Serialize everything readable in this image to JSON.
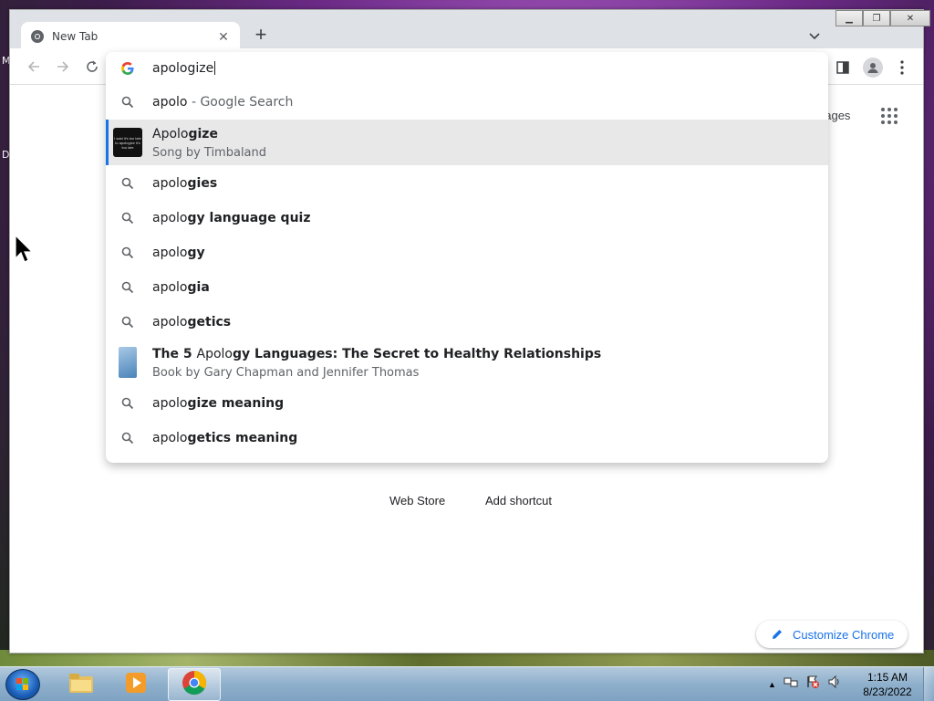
{
  "desktop": {
    "edge_letters": [
      "M",
      "D"
    ]
  },
  "browser": {
    "tab": {
      "title": "New Tab"
    },
    "omnibox": {
      "input_value": "apologize",
      "suggestions": [
        {
          "type": "search",
          "prefix": "apolo",
          "bold": "",
          "suffix": " - Google Search",
          "dim": true
        },
        {
          "type": "entity",
          "title_prefix": "Apolo",
          "title_bold": "gize",
          "subtitle": "Song by Timbaland",
          "thumb_text": "I said it's too late to apologize it's too late"
        },
        {
          "type": "search",
          "prefix": "apolo",
          "bold": "gies"
        },
        {
          "type": "search",
          "prefix": "apolo",
          "bold": "gy language quiz"
        },
        {
          "type": "search",
          "prefix": "apolo",
          "bold": "gy"
        },
        {
          "type": "search",
          "prefix": "apolo",
          "bold": "gia"
        },
        {
          "type": "search",
          "prefix": "apolo",
          "bold": "getics"
        },
        {
          "type": "entity",
          "title_bold_pre": "The 5 ",
          "title_prefix": "Apolo",
          "title_bold": "gy Languages: The Secret to Healthy Relationships",
          "subtitle": "Book by Gary Chapman and Jennifer Thomas"
        },
        {
          "type": "search",
          "prefix": "apolo",
          "bold": "gize meaning"
        },
        {
          "type": "search",
          "prefix": "apolo",
          "bold": "getics meaning"
        }
      ]
    },
    "ntp": {
      "images_link": "nages",
      "shortcuts": [
        "Web Store",
        "Add shortcut"
      ],
      "customize_label": "Customize Chrome"
    }
  },
  "taskbar": {
    "clock_time": "1:15 AM",
    "clock_date": "8/23/2022"
  },
  "colors": {
    "accent": "#1a73e8",
    "selected_row": "#e8e8e9",
    "titlebar": "#dee1e6"
  }
}
